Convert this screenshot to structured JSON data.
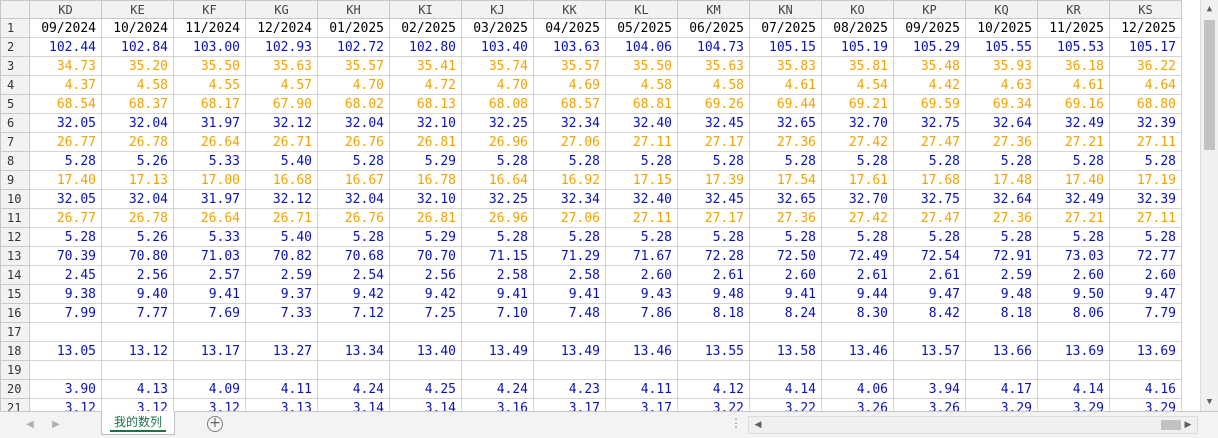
{
  "columns": [
    "KD",
    "KE",
    "KF",
    "KG",
    "KH",
    "KI",
    "KJ",
    "KK",
    "KL",
    "KM",
    "KN",
    "KO",
    "KP",
    "KQ",
    "KR",
    "KS"
  ],
  "rows": [
    {
      "n": "1",
      "style": "black",
      "cells": [
        "09/2024",
        "10/2024",
        "11/2024",
        "12/2024",
        "01/2025",
        "02/2025",
        "03/2025",
        "04/2025",
        "05/2025",
        "06/2025",
        "07/2025",
        "08/2025",
        "09/2025",
        "10/2025",
        "11/2025",
        "12/2025"
      ]
    },
    {
      "n": "2",
      "style": "blue",
      "cells": [
        "102.44",
        "102.84",
        "103.00",
        "102.93",
        "102.72",
        "102.80",
        "103.40",
        "103.63",
        "104.06",
        "104.73",
        "105.15",
        "105.19",
        "105.29",
        "105.55",
        "105.53",
        "105.17"
      ]
    },
    {
      "n": "3",
      "style": "orange",
      "cells": [
        "34.73",
        "35.20",
        "35.50",
        "35.63",
        "35.57",
        "35.41",
        "35.74",
        "35.57",
        "35.50",
        "35.63",
        "35.83",
        "35.81",
        "35.48",
        "35.93",
        "36.18",
        "36.22"
      ]
    },
    {
      "n": "4",
      "style": "orange",
      "cells": [
        "4.37",
        "4.58",
        "4.55",
        "4.57",
        "4.70",
        "4.72",
        "4.70",
        "4.69",
        "4.58",
        "4.58",
        "4.61",
        "4.54",
        "4.42",
        "4.63",
        "4.61",
        "4.64"
      ]
    },
    {
      "n": "5",
      "style": "orange",
      "cells": [
        "68.54",
        "68.37",
        "68.17",
        "67.90",
        "68.02",
        "68.13",
        "68.08",
        "68.57",
        "68.81",
        "69.26",
        "69.44",
        "69.21",
        "69.59",
        "69.34",
        "69.16",
        "68.80"
      ]
    },
    {
      "n": "6",
      "style": "blue",
      "cells": [
        "32.05",
        "32.04",
        "31.97",
        "32.12",
        "32.04",
        "32.10",
        "32.25",
        "32.34",
        "32.40",
        "32.45",
        "32.65",
        "32.70",
        "32.75",
        "32.64",
        "32.49",
        "32.39"
      ]
    },
    {
      "n": "7",
      "style": "orange",
      "cells": [
        "26.77",
        "26.78",
        "26.64",
        "26.71",
        "26.76",
        "26.81",
        "26.96",
        "27.06",
        "27.11",
        "27.17",
        "27.36",
        "27.42",
        "27.47",
        "27.36",
        "27.21",
        "27.11"
      ]
    },
    {
      "n": "8",
      "style": "blue",
      "cells": [
        "5.28",
        "5.26",
        "5.33",
        "5.40",
        "5.28",
        "5.29",
        "5.28",
        "5.28",
        "5.28",
        "5.28",
        "5.28",
        "5.28",
        "5.28",
        "5.28",
        "5.28",
        "5.28"
      ]
    },
    {
      "n": "9",
      "style": "orange",
      "cells": [
        "17.40",
        "17.13",
        "17.00",
        "16.68",
        "16.67",
        "16.78",
        "16.64",
        "16.92",
        "17.15",
        "17.39",
        "17.54",
        "17.61",
        "17.68",
        "17.48",
        "17.40",
        "17.19"
      ]
    },
    {
      "n": "10",
      "style": "blue",
      "cells": [
        "32.05",
        "32.04",
        "31.97",
        "32.12",
        "32.04",
        "32.10",
        "32.25",
        "32.34",
        "32.40",
        "32.45",
        "32.65",
        "32.70",
        "32.75",
        "32.64",
        "32.49",
        "32.39"
      ]
    },
    {
      "n": "11",
      "style": "orange",
      "cells": [
        "26.77",
        "26.78",
        "26.64",
        "26.71",
        "26.76",
        "26.81",
        "26.96",
        "27.06",
        "27.11",
        "27.17",
        "27.36",
        "27.42",
        "27.47",
        "27.36",
        "27.21",
        "27.11"
      ]
    },
    {
      "n": "12",
      "style": "blue",
      "cells": [
        "5.28",
        "5.26",
        "5.33",
        "5.40",
        "5.28",
        "5.29",
        "5.28",
        "5.28",
        "5.28",
        "5.28",
        "5.28",
        "5.28",
        "5.28",
        "5.28",
        "5.28",
        "5.28"
      ]
    },
    {
      "n": "13",
      "style": "blue",
      "cells": [
        "70.39",
        "70.80",
        "71.03",
        "70.82",
        "70.68",
        "70.70",
        "71.15",
        "71.29",
        "71.67",
        "72.28",
        "72.50",
        "72.49",
        "72.54",
        "72.91",
        "73.03",
        "72.77"
      ]
    },
    {
      "n": "14",
      "style": "blue",
      "cells": [
        "2.45",
        "2.56",
        "2.57",
        "2.59",
        "2.54",
        "2.56",
        "2.58",
        "2.58",
        "2.60",
        "2.61",
        "2.60",
        "2.61",
        "2.61",
        "2.59",
        "2.60",
        "2.60"
      ]
    },
    {
      "n": "15",
      "style": "blue",
      "cells": [
        "9.38",
        "9.40",
        "9.41",
        "9.37",
        "9.42",
        "9.42",
        "9.41",
        "9.41",
        "9.43",
        "9.48",
        "9.41",
        "9.44",
        "9.47",
        "9.48",
        "9.50",
        "9.47"
      ]
    },
    {
      "n": "16",
      "style": "blue",
      "cells": [
        "7.99",
        "7.77",
        "7.69",
        "7.33",
        "7.12",
        "7.25",
        "7.10",
        "7.48",
        "7.86",
        "8.18",
        "8.24",
        "8.30",
        "8.42",
        "8.18",
        "8.06",
        "7.79"
      ]
    },
    {
      "n": "17",
      "style": "blue",
      "cells": [
        "",
        "",
        "",
        "",
        "",
        "",
        "",
        "",
        "",
        "",
        "",
        "",
        "",
        "",
        "",
        ""
      ]
    },
    {
      "n": "18",
      "style": "blue",
      "cells": [
        "13.05",
        "13.12",
        "13.17",
        "13.27",
        "13.34",
        "13.40",
        "13.49",
        "13.49",
        "13.46",
        "13.55",
        "13.58",
        "13.46",
        "13.57",
        "13.66",
        "13.69",
        "13.69"
      ]
    },
    {
      "n": "19",
      "style": "blue",
      "cells": [
        "",
        "",
        "",
        "",
        "",
        "",
        "",
        "",
        "",
        "",
        "",
        "",
        "",
        "",
        "",
        ""
      ]
    },
    {
      "n": "20",
      "style": "blue",
      "cells": [
        "3.90",
        "4.13",
        "4.09",
        "4.11",
        "4.24",
        "4.25",
        "4.24",
        "4.23",
        "4.11",
        "4.12",
        "4.14",
        "4.06",
        "3.94",
        "4.17",
        "4.14",
        "4.16"
      ]
    },
    {
      "n": "21",
      "style": "blue",
      "cells": [
        "3.12",
        "3.12",
        "3.12",
        "3.13",
        "3.14",
        "3.14",
        "3.16",
        "3.17",
        "3.17",
        "3.22",
        "3.22",
        "3.26",
        "3.26",
        "3.29",
        "3.29",
        "3.29"
      ]
    }
  ],
  "sheet_tab": {
    "label": "我的数列"
  },
  "icons": {
    "add_sheet": "plus-circle-icon",
    "nav_prev": "triangle-left-icon",
    "nav_next": "triangle-right-icon"
  },
  "colors": {
    "blue": "#0a10b8",
    "orange": "#f2a300",
    "tab_green": "#1e7145"
  }
}
